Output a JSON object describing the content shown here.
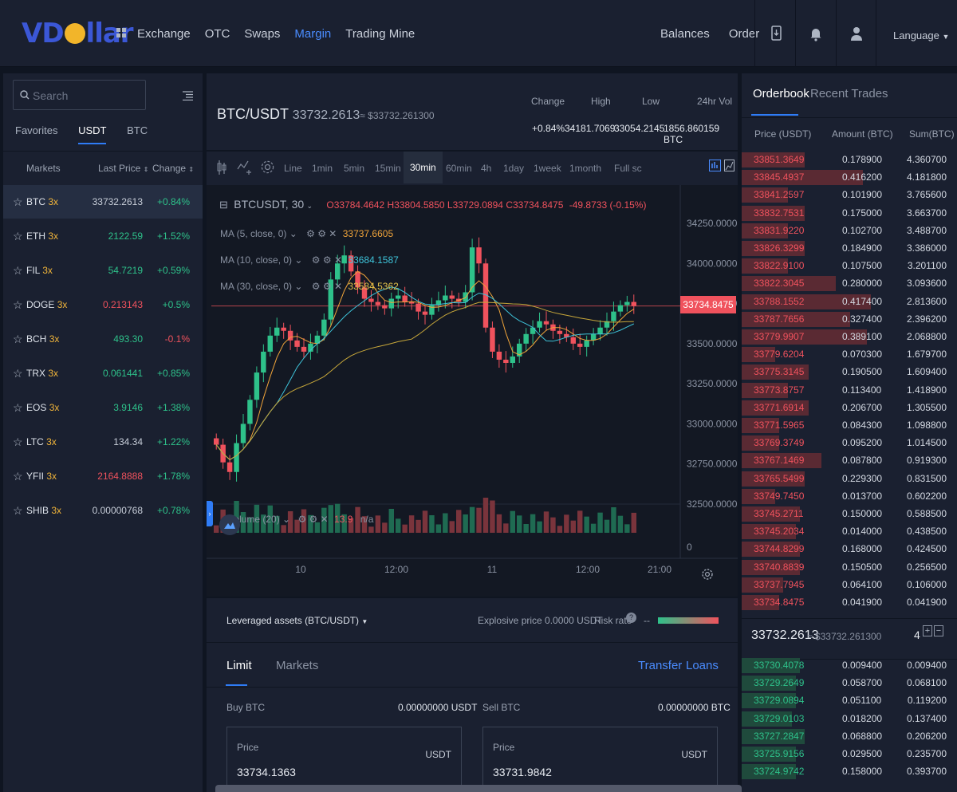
{
  "header": {
    "logo": "VDollar",
    "nav": [
      "Exchange",
      "OTC",
      "Swaps",
      "Margin",
      "Trading Mine"
    ],
    "active_nav": "Margin",
    "right_nav": [
      "Balances",
      "Order"
    ],
    "language": "Language"
  },
  "markets_panel": {
    "search_placeholder": "Search",
    "tabs": [
      "Favorites",
      "USDT",
      "BTC"
    ],
    "active_tab": "USDT",
    "col_markets": "Markets",
    "col_last_price": "Last Price",
    "col_change": "Change",
    "rows": [
      {
        "symbol": "BTC",
        "lev": "3x",
        "price": "33732.2613",
        "change": "+0.84%",
        "pc": "white",
        "cc": "green"
      },
      {
        "symbol": "ETH",
        "lev": "3x",
        "price": "2122.59",
        "change": "+1.52%",
        "pc": "green",
        "cc": "green"
      },
      {
        "symbol": "FIL",
        "lev": "3x",
        "price": "54.7219",
        "change": "+0.59%",
        "pc": "green",
        "cc": "green"
      },
      {
        "symbol": "DOGE",
        "lev": "3x",
        "price": "0.213143",
        "change": "+0.5%",
        "pc": "red",
        "cc": "green"
      },
      {
        "symbol": "BCH",
        "lev": "3x",
        "price": "493.30",
        "change": "-0.1%",
        "pc": "green",
        "cc": "red"
      },
      {
        "symbol": "TRX",
        "lev": "3x",
        "price": "0.061441",
        "change": "+0.85%",
        "pc": "green",
        "cc": "green"
      },
      {
        "symbol": "EOS",
        "lev": "3x",
        "price": "3.9146",
        "change": "+1.38%",
        "pc": "green",
        "cc": "green"
      },
      {
        "symbol": "LTC",
        "lev": "3x",
        "price": "134.34",
        "change": "+1.22%",
        "pc": "white",
        "cc": "green"
      },
      {
        "symbol": "YFII",
        "lev": "3x",
        "price": "2164.8888",
        "change": "+1.78%",
        "pc": "red",
        "cc": "green"
      },
      {
        "symbol": "SHIB",
        "lev": "3x",
        "price": "0.00000768",
        "change": "+0.78%",
        "pc": "white",
        "cc": "green"
      }
    ]
  },
  "ticker": {
    "pair": "BTC/USDT",
    "last": "33732.2613",
    "approx": "≈ $33732.261300",
    "labels": [
      "Change",
      "High",
      "Low",
      "24hr Vol"
    ],
    "change": "+0.84%",
    "high": "34181.7069",
    "low": "33054.2145",
    "vol": "1856.860159 BTC"
  },
  "chart_toolbar": {
    "timeframes": [
      "Line",
      "1min",
      "5min",
      "15min",
      "30min",
      "60min",
      "4h",
      "1day",
      "1week",
      "1month",
      "Full sc"
    ],
    "active": "30min"
  },
  "chart_legend": {
    "symbol": "BTCUSDT, 30",
    "ohlc": {
      "o": "O33784.4642",
      "h": "H33804.5850",
      "l": "L33729.0894",
      "c": "C33734.8475",
      "chg": "-49.8733 (-0.15%)"
    },
    "ma5": {
      "label": "MA (5, close, 0)",
      "value": "33737.6605"
    },
    "ma10": {
      "label": "MA (10, close, 0)",
      "value": "33684.1587"
    },
    "ma30": {
      "label": "MA (30, close, 0)",
      "value": "33584.5362"
    },
    "volume": {
      "label": "Volume (20)",
      "value": "13.9",
      "na": "n/a"
    },
    "last_price_tag": "33734.8475"
  },
  "chart_data": {
    "type": "line",
    "title": "",
    "y_ticks": [
      "34250.0000",
      "34000.0000",
      "33750.0000",
      "33500.0000",
      "33250.0000",
      "33000.0000",
      "32750.0000",
      "32500.0000"
    ],
    "y_values": [
      34250,
      34000,
      33750,
      33500,
      33250,
      33000,
      32750,
      32500
    ],
    "vol_tick": "0",
    "x_ticks": [
      "10",
      "12:00",
      "11",
      "12:00",
      "21:00"
    ],
    "ylim": [
      32500,
      34250
    ],
    "close_series": [
      32870,
      32760,
      32700,
      32880,
      33000,
      33150,
      33320,
      33450,
      33550,
      33600,
      33580,
      33520,
      33480,
      33450,
      33500,
      33550,
      33650,
      33900,
      34000,
      34050,
      33950,
      33850,
      33780,
      33760,
      33740,
      33720,
      33780,
      33800,
      33760,
      33750,
      33700,
      33680,
      33740,
      33770,
      33800,
      33780,
      33760,
      33820,
      34100,
      34000,
      33600,
      33450,
      33400,
      33380,
      33420,
      33500,
      33560,
      33600,
      33640,
      33620,
      33580,
      33560,
      33540,
      33500,
      33480,
      33520,
      33560,
      33600,
      33640,
      33700,
      33740,
      33760,
      33735
    ]
  },
  "leverage": {
    "label": "Leveraged assets (BTC/USDT)",
    "explosive": "Explosive price 0.0000 USDT",
    "risk": "Risk rate",
    "dash": "--"
  },
  "order_tabs": {
    "tabs": [
      "Limit",
      "Markets"
    ],
    "active": "Limit",
    "links": [
      "Transfer",
      "Loans"
    ]
  },
  "buy": {
    "label": "Buy BTC",
    "balance": "0.00000000 USDT",
    "price_label": "Price",
    "price": "33734.1363",
    "unit": "USDT"
  },
  "sell": {
    "label": "Sell BTC",
    "balance": "0.00000000 BTC",
    "price_label": "Price",
    "price": "33731.9842",
    "unit": "USDT"
  },
  "orderbook": {
    "tabs": [
      "Orderbook",
      "Recent Trades"
    ],
    "active": "Orderbook",
    "cols": [
      "Price (USDT)",
      "Amount (BTC)",
      "Sum(BTC)"
    ],
    "asks": [
      [
        "33851.3649",
        "0.178900",
        "4.360700",
        0.3
      ],
      [
        "33845.4937",
        "0.416200",
        "4.181800",
        0.58
      ],
      [
        "33841.2597",
        "0.101900",
        "3.765600",
        0.22
      ],
      [
        "33832.7531",
        "0.175000",
        "3.663700",
        0.3
      ],
      [
        "33831.9220",
        "0.102700",
        "3.488700",
        0.22
      ],
      [
        "33826.3299",
        "0.184900",
        "3.386000",
        0.3
      ],
      [
        "33822.9100",
        "0.107500",
        "3.201100",
        0.22
      ],
      [
        "33822.3045",
        "0.280000",
        "3.093600",
        0.45
      ],
      [
        "33788.1552",
        "0.417400",
        "2.813600",
        0.62
      ],
      [
        "33787.7656",
        "0.327400",
        "2.396200",
        0.52
      ],
      [
        "33779.9907",
        "0.389100",
        "2.068800",
        0.6
      ],
      [
        "33779.6204",
        "0.070300",
        "1.679700",
        0.16
      ],
      [
        "33775.3145",
        "0.190500",
        "1.609400",
        0.32
      ],
      [
        "33773.8757",
        "0.113400",
        "1.418900",
        0.22
      ],
      [
        "33771.6914",
        "0.206700",
        "1.305500",
        0.32
      ],
      [
        "33771.5965",
        "0.084300",
        "1.098800",
        0.18
      ],
      [
        "33769.3749",
        "0.095200",
        "1.014500",
        0.18
      ],
      [
        "33767.1469",
        "0.087800",
        "0.919300",
        0.38
      ],
      [
        "33765.5499",
        "0.229300",
        "0.831500",
        0.3
      ],
      [
        "33749.7450",
        "0.013700",
        "0.602200",
        0.16
      ],
      [
        "33745.2711",
        "0.150000",
        "0.588500",
        0.28
      ],
      [
        "33745.2034",
        "0.014000",
        "0.438500",
        0.26
      ],
      [
        "33744.8299",
        "0.168000",
        "0.424500",
        0.28
      ],
      [
        "33740.8839",
        "0.150500",
        "0.256500",
        0.28
      ],
      [
        "33737.7945",
        "0.064100",
        "0.106000",
        0.2
      ],
      [
        "33734.8475",
        "0.041900",
        "0.041900",
        0.18
      ]
    ],
    "mid_price": "33732.2613",
    "mid_approx": "≈ $33732.261300",
    "depth": "4",
    "bids": [
      [
        "33730.4078",
        "0.009400",
        "0.009400",
        0.28
      ],
      [
        "33729.2649",
        "0.058700",
        "0.068100",
        0.26
      ],
      [
        "33729.0894",
        "0.051100",
        "0.119200",
        0.26
      ],
      [
        "33729.0103",
        "0.018200",
        "0.137400",
        0.24
      ],
      [
        "33727.2847",
        "0.068800",
        "0.206200",
        0.3
      ],
      [
        "33725.9156",
        "0.029500",
        "0.235700",
        0.26
      ],
      [
        "33724.9742",
        "0.158000",
        "0.393700",
        0.26
      ]
    ]
  }
}
